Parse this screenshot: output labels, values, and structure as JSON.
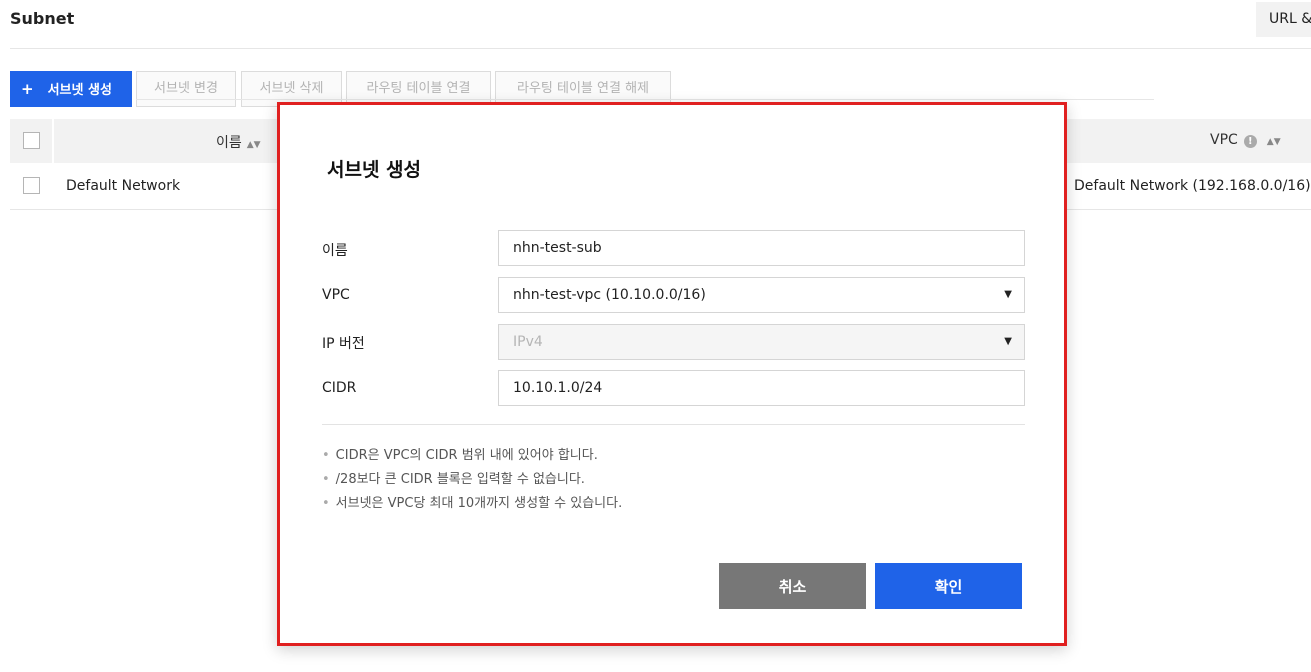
{
  "page": {
    "title": "Subnet",
    "url_button": "URL &"
  },
  "toolbar": {
    "create_plus": "+",
    "create": "서브넷 생성",
    "change": "서브넷 변경",
    "delete": "서브넷 삭제",
    "route_attach": "라우팅 테이블 연결",
    "route_detach": "라우팅 테이블 연결 해제"
  },
  "table": {
    "headers": {
      "name": "이름",
      "vpc": "VPC"
    },
    "rows": [
      {
        "name": "Default Network",
        "vpc": "Default Network (192.168.0.0/16)"
      }
    ]
  },
  "modal": {
    "title": "서브넷 생성",
    "fields": {
      "name": {
        "label": "이름",
        "value": "nhn-test-sub"
      },
      "vpc": {
        "label": "VPC",
        "value": "nhn-test-vpc (10.10.0.0/16)"
      },
      "ip_version": {
        "label": "IP 버전",
        "value": "IPv4",
        "disabled": true
      },
      "cidr": {
        "label": "CIDR",
        "value": "10.10.1.0/24"
      }
    },
    "notes": [
      "CIDR은 VPC의 CIDR 범위 내에 있어야 합니다.",
      "/28보다 큰 CIDR 블록은 입력할 수 없습니다.",
      "서브넷은 VPC당 최대 10개까지 생성할 수 있습니다."
    ],
    "buttons": {
      "cancel": "취소",
      "confirm": "확인"
    }
  },
  "icons": {
    "sort": "sort-updown-icon",
    "info": "info-icon",
    "dropdown": "caret-down-icon"
  },
  "colors": {
    "primary": "#1f63e8",
    "cancel": "#777777",
    "highlight_border": "#e02020"
  }
}
